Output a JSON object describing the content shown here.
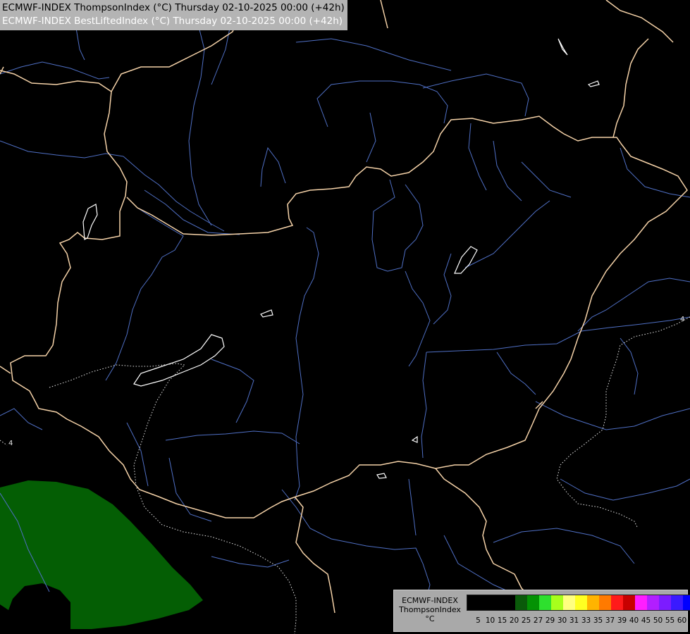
{
  "header": {
    "line1": "ECMWF-INDEX ThompsonIndex (°C) Thursday 02-10-2025 00:00 (+42h)",
    "line2": "ECMWF-INDEX BestLiftedIndex (°C) Thursday 02-10-2025 00:00 (+42h)",
    "line1_color": "#000000",
    "line2_color": "#ffffff"
  },
  "map": {
    "background_color": "#000000",
    "border_color": "#f5d2a8",
    "river_color": "#4f6fc4",
    "lake_outline_color": "#ffffff",
    "lifted_index_contour_color": "#e6e6e6",
    "shaded_region_color": "#045e04",
    "contour_labels": [
      "4",
      "4"
    ]
  },
  "legend": {
    "title_lines": [
      "ECMWF-INDEX",
      "ThompsonIndex",
      "°C"
    ],
    "colors": [
      "#000000",
      "#000000",
      "#000000",
      "#000000",
      "#0a5a0a",
      "#049204",
      "#2ee02e",
      "#a8ff1c",
      "#ffff80",
      "#ffff22",
      "#ffb400",
      "#ff7a00",
      "#ff1a1a",
      "#c80000",
      "#ff1eff",
      "#b21eff",
      "#7c1cff",
      "#3a1aff",
      "#0000ff"
    ],
    "ticks": [
      "5",
      "10",
      "15",
      "20",
      "25",
      "27",
      "29",
      "30",
      "31",
      "33",
      "35",
      "37",
      "39",
      "40",
      "45",
      "50",
      "55",
      "60"
    ]
  }
}
